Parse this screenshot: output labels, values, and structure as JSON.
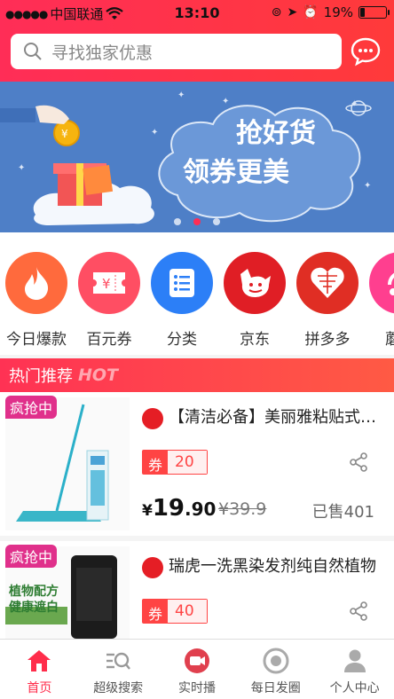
{
  "status_bar": {
    "carrier": "中国联通",
    "time": "13:10",
    "battery_text": "19%",
    "battery_level": 0.19
  },
  "search": {
    "placeholder": "寻找独家优惠",
    "message_icon": "chat-bubble-icon"
  },
  "banner": {
    "line1": "抢好货",
    "line2": "领券更美",
    "slides": 3,
    "active_slide": 2
  },
  "categories": [
    {
      "label": "今日爆款",
      "icon": "flame-icon",
      "color": "#ff6a3d"
    },
    {
      "label": "百元券",
      "icon": "ticket-icon",
      "color": "#ff4e63"
    },
    {
      "label": "分类",
      "icon": "list-icon",
      "color": "#2c7ff7"
    },
    {
      "label": "京东",
      "icon": "jd-dog-icon",
      "color": "#e01e25"
    },
    {
      "label": "拼多多",
      "icon": "pinduoduo-icon",
      "color": "#e02e24"
    },
    {
      "label": "蘑菇",
      "icon": "mogu-icon",
      "color": "#ff3f8f"
    }
  ],
  "section": {
    "title": "热门推荐",
    "title_en": "HOT"
  },
  "products": [
    {
      "badge": "疯抢中",
      "title": "【清洁必备】美丽雅粘贴式平板拖把",
      "coupon_label": "券",
      "coupon_value": "20",
      "price_symbol": "¥",
      "price_int": "19",
      "price_dec": ".90",
      "original_price": "¥39.9",
      "sold": "已售401"
    },
    {
      "badge": "疯抢中",
      "title": "瑞虎一洗黑染发剂纯自然植物",
      "coupon_label": "券",
      "coupon_value": "40",
      "image_text_1": "植物配方",
      "image_text_2": "健康遮白"
    }
  ],
  "tabbar": [
    {
      "label": "首页",
      "icon": "home-icon",
      "active": true
    },
    {
      "label": "超级搜索",
      "icon": "super-search-icon",
      "active": false
    },
    {
      "label": "实时播",
      "icon": "video-icon",
      "active": false
    },
    {
      "label": "每日发圈",
      "icon": "circle-icon",
      "active": false
    },
    {
      "label": "个人中心",
      "icon": "person-icon",
      "active": false
    }
  ],
  "colors": {
    "brand_red": "#ff2d57",
    "accent": "#ff4444",
    "badge_pink": "#e0308b"
  }
}
